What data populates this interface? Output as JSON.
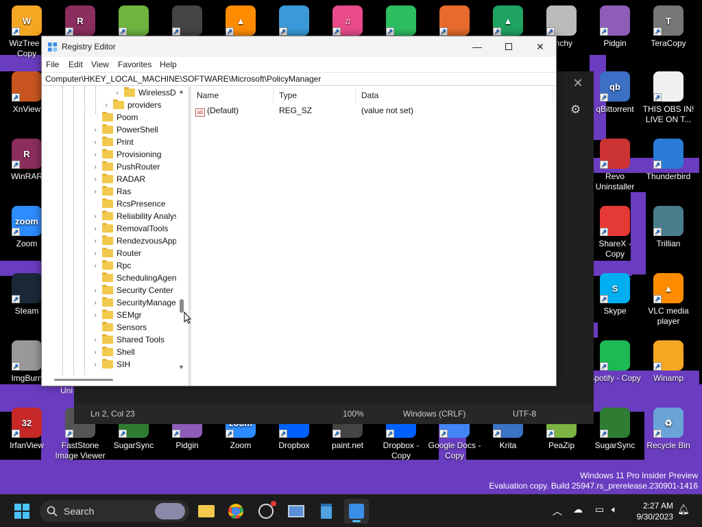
{
  "desktop": {
    "icons": [
      {
        "label": "WizTree - Copy",
        "color": "#f5a623",
        "glyph": "W"
      },
      {
        "label": "WinRAR",
        "color": "#8b2e5e",
        "glyph": "R"
      },
      {
        "label": "",
        "color": "#6fb43f",
        "glyph": ""
      },
      {
        "label": "",
        "color": "#444",
        "glyph": ""
      },
      {
        "label": "",
        "color": "#ff8c00",
        "glyph": "▲"
      },
      {
        "label": "",
        "color": "#3a9ad9",
        "glyph": ""
      },
      {
        "label": "",
        "color": "#e94c89",
        "glyph": "♫"
      },
      {
        "label": "",
        "color": "#2dbe60",
        "glyph": ""
      },
      {
        "label": "",
        "color": "#e66b2c",
        "glyph": ""
      },
      {
        "label": "",
        "color": "#1fa463",
        "glyph": "▲"
      },
      {
        "label": "unchy",
        "color": "#bbbbbb",
        "glyph": ""
      },
      {
        "label": "Pidgin",
        "color": "#8e5db8",
        "glyph": ""
      },
      {
        "label": "TeraCopy",
        "color": "#777",
        "glyph": "T"
      },
      {
        "label": "XnView",
        "color": "#c8551f",
        "glyph": ""
      },
      {
        "label": "qBittorrent",
        "color": "#3b70c4",
        "glyph": "qb"
      },
      {
        "label": "THIS OBS IN! LIVE ON T...",
        "color": "#f0f0f0",
        "glyph": ""
      },
      {
        "label": "WinRAR",
        "color": "#8b2e5e",
        "glyph": "R"
      },
      {
        "label": "Revo Uninstaller",
        "color": "#c33",
        "glyph": ""
      },
      {
        "label": "Thunderbird",
        "color": "#2a7bd6",
        "glyph": ""
      },
      {
        "label": "Zoom",
        "color": "#2d8cff",
        "glyph": "zoom"
      },
      {
        "label": "ShareX - Copy",
        "color": "#e53935",
        "glyph": ""
      },
      {
        "label": "Trillian",
        "color": "#4a7d8c",
        "glyph": ""
      },
      {
        "label": "Steam",
        "color": "#1b2838",
        "glyph": ""
      },
      {
        "label": "Skype",
        "color": "#00aff0",
        "glyph": "S"
      },
      {
        "label": "VLC media player",
        "color": "#ff8c00",
        "glyph": "▲"
      },
      {
        "label": "ImgBurn",
        "color": "#999",
        "glyph": ""
      },
      {
        "label": "Spotify - Copy",
        "color": "#1db954",
        "glyph": ""
      },
      {
        "label": "Winamp",
        "color": "#f5a623",
        "glyph": ""
      },
      {
        "label": "IrfanView",
        "color": "#c62828",
        "glyph": "32"
      },
      {
        "label": "FastStone Image Viewer",
        "color": "#555",
        "glyph": ""
      },
      {
        "label": "SugarSync",
        "color": "#2e7d32",
        "glyph": ""
      },
      {
        "label": "Pidgin",
        "color": "#8e5db8",
        "glyph": ""
      },
      {
        "label": "Zoom",
        "color": "#2d8cff",
        "glyph": "zoom"
      },
      {
        "label": "Dropbox",
        "color": "#0061ff",
        "glyph": ""
      },
      {
        "label": "paint.net",
        "color": "#444",
        "glyph": ""
      },
      {
        "label": "Dropbox - Copy",
        "color": "#0061ff",
        "glyph": ""
      },
      {
        "label": "Google Docs - Copy",
        "color": "#4285f4",
        "glyph": ""
      },
      {
        "label": "Krita",
        "color": "#3b73c4",
        "glyph": ""
      },
      {
        "label": "PeaZip",
        "color": "#7cb342",
        "glyph": ""
      },
      {
        "label": "SugarSync",
        "color": "#2e7d32",
        "glyph": ""
      },
      {
        "label": "Recycle Bin",
        "color": "#6aa3d8",
        "glyph": "♻"
      }
    ],
    "partial_label": "Uni"
  },
  "notepad": {
    "status_position": "Ln 2, Col 23",
    "status_zoom": "100%",
    "status_eol": "Windows (CRLF)",
    "status_encoding": "UTF-8"
  },
  "regedit": {
    "title": "Registry Editor",
    "menu": [
      "File",
      "Edit",
      "View",
      "Favorites",
      "Help"
    ],
    "address": "Computer\\HKEY_LOCAL_MACHINE\\SOFTWARE\\Microsoft\\PolicyManager",
    "tree": [
      {
        "label": "WirelessDis",
        "level": 2,
        "has_children": true
      },
      {
        "label": "providers",
        "level": 1,
        "has_children": true
      },
      {
        "label": "Poom",
        "level": 0,
        "has_children": false
      },
      {
        "label": "PowerShell",
        "level": 0,
        "has_children": true
      },
      {
        "label": "Print",
        "level": 0,
        "has_children": true
      },
      {
        "label": "Provisioning",
        "level": 0,
        "has_children": true
      },
      {
        "label": "PushRouter",
        "level": 0,
        "has_children": true
      },
      {
        "label": "RADAR",
        "level": 0,
        "has_children": true
      },
      {
        "label": "Ras",
        "level": 0,
        "has_children": true
      },
      {
        "label": "RcsPresence",
        "level": 0,
        "has_children": false
      },
      {
        "label": "Reliability Analys",
        "level": 0,
        "has_children": true
      },
      {
        "label": "RemovalTools",
        "level": 0,
        "has_children": true
      },
      {
        "label": "RendezvousApps",
        "level": 0,
        "has_children": true
      },
      {
        "label": "Router",
        "level": 0,
        "has_children": true
      },
      {
        "label": "Rpc",
        "level": 0,
        "has_children": true
      },
      {
        "label": "SchedulingAgent",
        "level": 0,
        "has_children": false
      },
      {
        "label": "Security Center",
        "level": 0,
        "has_children": true
      },
      {
        "label": "SecurityManager",
        "level": 0,
        "has_children": true
      },
      {
        "label": "SEMgr",
        "level": 0,
        "has_children": true
      },
      {
        "label": "Sensors",
        "level": 0,
        "has_children": false
      },
      {
        "label": "Shared Tools",
        "level": 0,
        "has_children": true
      },
      {
        "label": "Shell",
        "level": 0,
        "has_children": true
      },
      {
        "label": "SIH",
        "level": 0,
        "has_children": true
      }
    ],
    "columns": [
      "Name",
      "Type",
      "Data"
    ],
    "values": [
      {
        "name": "(Default)",
        "type": "REG_SZ",
        "data": "(value not set)"
      }
    ]
  },
  "watermark": {
    "line1": "Windows 11 Pro Insider Preview",
    "line2": "Evaluation copy. Build 25947.rs_prerelease.230901-1416"
  },
  "taskbar": {
    "search_placeholder": "Search",
    "time": "2:27 AM",
    "date": "9/30/2023"
  }
}
